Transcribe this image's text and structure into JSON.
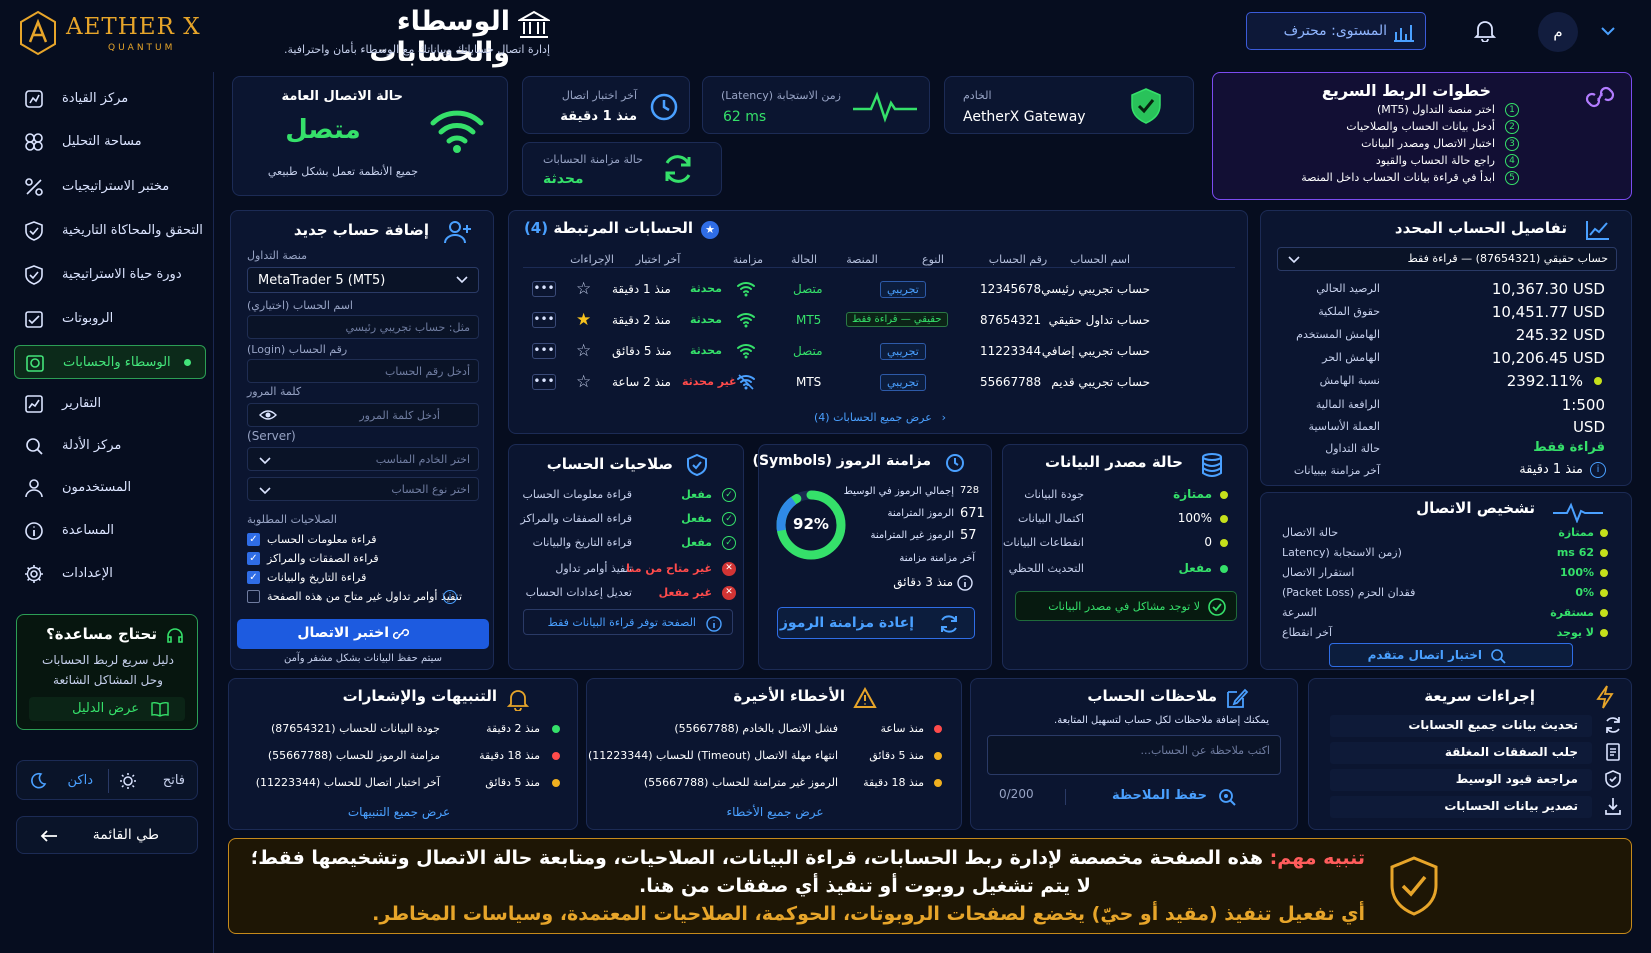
{
  "brand": {
    "name": "AETHER X",
    "sub": "QUANTUM"
  },
  "header": {
    "title": "الوسطاء والحسابات",
    "subtitle": "إدارة اتصال حساباتك وبياناتك مع الوسطاء بأمان واحترافية.",
    "level": "المستوى: محترف",
    "avatar": "م"
  },
  "sidebar": {
    "items": [
      {
        "label": "مركز القيادة",
        "icon": "dashboard-icon"
      },
      {
        "label": "مساحة التحليل",
        "icon": "analysis-icon"
      },
      {
        "label": "مختبر الاستراتيجيات",
        "icon": "percent-icon"
      },
      {
        "label": "التحقق والمحاكاة التاريخية",
        "icon": "shield-check-icon"
      },
      {
        "label": "دورة حياة الاستراتيجية",
        "icon": "shield-icon"
      },
      {
        "label": "الروبوتات",
        "icon": "robot-icon"
      },
      {
        "label": "الوسطاء والحسابات",
        "icon": "broker-icon"
      },
      {
        "label": "التقارير",
        "icon": "report-icon"
      },
      {
        "label": "مركز الأدلة",
        "icon": "evidence-icon"
      },
      {
        "label": "المستخدمون",
        "icon": "user-icon"
      },
      {
        "label": "المساعدة",
        "icon": "info-icon"
      },
      {
        "label": "الإعدادات",
        "icon": "gear-icon"
      }
    ],
    "help": {
      "title": "تحتاج مساعدة؟",
      "text1": "دليل سريع لربط الحسابات",
      "text2": "وحل المشاكل الشائعة",
      "button": "عرض الدليل"
    },
    "theme": {
      "light": "فاتح",
      "dark": "داكن"
    },
    "collapse": "طي القائمة"
  },
  "status": {
    "conn_title": "حالة الاتصال العامة",
    "conn_value": "متصل",
    "conn_sub": "جميع الأنظمة تعمل بشكل طبيعي",
    "last_test_label": "آخر اختبار اتصال",
    "last_test_value": "منذ 1 دقيقة",
    "latency_label": "زمن الاستجابة (Latency)",
    "latency_value": "62 ms",
    "server_label": "الخادم",
    "server_value": "AetherX Gateway",
    "sync_label": "حالة مزامنة الحسابات",
    "sync_value": "محدثة"
  },
  "quick_steps": {
    "title": "خطوات الربط السريع",
    "steps": [
      "اختر منصة التداول (MT5)",
      "أدخل بيانات الحساب والصلاحيات",
      "اختبار الاتصال ومصدر البيانات",
      "راجع حالة الحساب والقيود",
      "ابدأ في قراءة بيانات الحساب داخل المنصة"
    ]
  },
  "add_account": {
    "title": "إضافة حساب جديد",
    "platform_label": "منصة التداول",
    "platform_value": "MetaTrader 5 (MT5)",
    "name_label": "اسم الحساب (اختياري)",
    "name_placeholder": "مثل: حساب تجريبي رئيسي",
    "login_label": "رقم الحساب (Login)",
    "login_placeholder": "أدخل رقم الحساب",
    "password_label": "كلمة المرور",
    "password_placeholder": "أدخل كلمة المرور",
    "server_label": "(Server)",
    "server_placeholder": "اختر الخادم المناسب",
    "type_placeholder": "اختر نوع الحساب",
    "perms_label": "الصلاحيات المطلوبة",
    "perms": [
      "قراءة معلومات الحساب",
      "قراءة الصفقات والمراكز",
      "قراءة التاريخ والبيانات",
      "تنفيذ أوامر تداول غير متاح من هذه الصفحة"
    ],
    "button": "اختبر الاتصال",
    "note": "سيتم حفظ البيانات بشكل مشفر وآمن"
  },
  "linked": {
    "title": "الحسابات المرتبطة",
    "count": "(4)",
    "headers": [
      "اسم الحساب",
      "رقم الحساب",
      "النوع",
      "المنصة",
      "الحالة",
      "مزامنة",
      "آخر اختبار",
      "الإجراءات"
    ],
    "rows": [
      {
        "name": "حساب تجريبي رئيسي",
        "number": "12345678",
        "type": "تجريبي",
        "platform": "متصل",
        "sync": "محدثة",
        "last": "منذ 1 دقيقة"
      },
      {
        "name": "حساب تداول حقيقي",
        "number": "87654321",
        "type": "حقيقي — قراءة فقط",
        "platform": "MT5",
        "sync": "محدثة",
        "last": "منذ 2 دقيقة"
      },
      {
        "name": "حساب تجريبي إضافي",
        "number": "11223344",
        "type": "تجريبي",
        "platform": "متصل",
        "sync": "محدثة",
        "last": "منذ 5 دقائق"
      },
      {
        "name": "حساب تجريبي قديم",
        "number": "55667788",
        "type": "تجريبي",
        "platform": "MTS",
        "sync": "غير محدثة",
        "last": "منذ 2 ساعة"
      }
    ],
    "view_all": "عرض جميع الحسابات (4)"
  },
  "details": {
    "title": "تفاصيل الحساب المحدد",
    "selector": "حساب حقيقي (87654321) — قراءة فقط",
    "rows": [
      {
        "label": "الرصيد الحالي",
        "value": "10,367.30 USD"
      },
      {
        "label": "حقوق الملكية",
        "value": "10,451.77 USD"
      },
      {
        "label": "الهامش المستخدم",
        "value": "245.32 USD"
      },
      {
        "label": "الهامش الحر",
        "value": "10,206.45 USD"
      },
      {
        "label": "نسبة الهامش",
        "value": "2392.11%"
      },
      {
        "label": "الرافعة المالية",
        "value": "1:500"
      },
      {
        "label": "العملة الأساسية",
        "value": "USD"
      },
      {
        "label": "حالة التداول",
        "value": "قراءة فقط"
      },
      {
        "label": "آخر مزامنة بيبيانات",
        "value": "منذ 1 دقيقة"
      }
    ]
  },
  "permissions": {
    "title": "صلاحيات الحساب",
    "rows": [
      {
        "label": "قراءة معلومات الحساب",
        "value": "مفعل"
      },
      {
        "label": "قراءة الصفقات والمراكز",
        "value": "مفعل"
      },
      {
        "label": "قراءة التاريخ والبيانات",
        "value": "مفعل"
      },
      {
        "label": "تنفيذ أوامر تداول",
        "value": "غير متاح من منا"
      },
      {
        "label": "تعديل إعدادات الحساب",
        "value": "غير مفعل"
      }
    ],
    "note": "الصفحة توفر قراءة البيانات فقط"
  },
  "symbols": {
    "title": "مزامنة الرموز (Symbols)",
    "percent": "92%",
    "progress": 0.92,
    "rows": [
      {
        "label": "إجمالي الرموز في الوسيط",
        "value": "728"
      },
      {
        "label": "الرموز المترامنة",
        "value": "671"
      },
      {
        "label": "الرموز غير المترامنة",
        "value": "57"
      }
    ],
    "last_label": "آخر مزامنة مزامنة",
    "last_value": "منذ 3 دقائق",
    "button": "إعادة مزامنة الرموز"
  },
  "datasource": {
    "title": "حالة مصدر البيانات",
    "rows": [
      {
        "label": "جودة البيانات",
        "value": "ممتازة"
      },
      {
        "label": "اكتمال البيانات",
        "value": "100%"
      },
      {
        "label": "انقطاعات البيانات",
        "value": "0"
      },
      {
        "label": "التحديث اللحظي",
        "value": "مفعل"
      }
    ],
    "ok": "لا توجد مشاكل في مصدر البيانات"
  },
  "diagnostics": {
    "title": "تشخيص الاتصال",
    "rows": [
      {
        "label": "حالة الاتصال",
        "value": "ممتازة"
      },
      {
        "label": "(زمن الاستجابة (Latency",
        "value": "62 ms"
      },
      {
        "label": "استقرار الاتصال",
        "value": "100%"
      },
      {
        "label": "فقدان الحزم (Packet Loss)",
        "value": "0%"
      },
      {
        "label": "السرعة",
        "value": "مستقرة"
      },
      {
        "label": "آخر انقطاع",
        "value": "لا يوجد"
      }
    ],
    "button": "اختبار اتصال متقدم"
  },
  "alerts": {
    "title": "التنبيهات والإشعارات",
    "rows": [
      {
        "text": "جودة البيانات للحساب (87654321)",
        "time": "منذ 2 دقيقة"
      },
      {
        "text": "مزامنة الرموز للحساب (55667788)",
        "time": "منذ 18 دقيقة"
      },
      {
        "text": "آخر اختبار اتصال للحساب (11223344)",
        "time": "منذ 5 دقائق"
      }
    ],
    "view_all": "عرض جميع التنبيهات"
  },
  "errors": {
    "title": "الأخطاء الأخيرة",
    "rows": [
      {
        "text": "فشل الاتصال بالخادم (55667788)",
        "time": "منذ ساعة"
      },
      {
        "text": "انتهاء مهلة الاتصال (Timeout) للحساب (11223344)",
        "time": "منذ 5 دقائق"
      },
      {
        "text": "الرموز غير مترامنة للحساب (55667788)",
        "time": "منذ 18 دقيقة"
      }
    ],
    "view_all": "عرض جميع الأخطاء"
  },
  "notes": {
    "title": "ملاحظات الحساب",
    "desc": "يمكنك إضافة ملاحظات لكل حساب لتسهيل المتابعة.",
    "placeholder": "اكتب ملاحظة عن الحساب...",
    "counter": "0/200",
    "button": "حفظ الملاحظة"
  },
  "quick_actions": {
    "title": "إجراءات سريعة",
    "items": [
      "تحديث بيانات جميع الحسابات",
      "جلب الصفقات المغلقة",
      "مراجعة قيود الوسيط",
      "تصدير بيانات الحسابات"
    ]
  },
  "warning": {
    "label": "تنبيه مهم:",
    "line1": "هذه الصفحة مخصصة لإدارة ربط الحسابات، قراءة البيانات، الصلاحيات، ومتابعة حالة الاتصال وتشخيصها فقط؛",
    "line2": "لا يتم تشغيل روبوت أو تنفيذ أي صفقات من هنا.",
    "line3": "أي تفعيل تنفيذ (مقيد أو حيّ) يخضع لصفحات الروبوتات، الحوكمة، الصلاحيات المعتمدة، وسياسات المخاطر."
  }
}
